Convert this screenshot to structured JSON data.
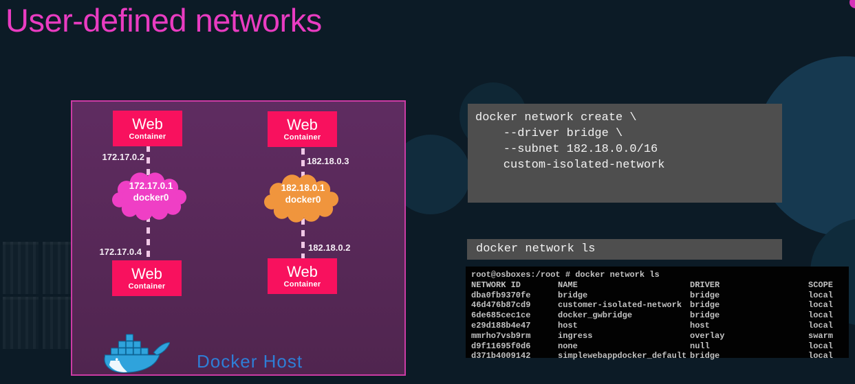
{
  "slide": {
    "title": "User-defined networks"
  },
  "colors": {
    "background": "#0c1b26",
    "title_magenta": "#e93cc1",
    "panel_purple": "#5a2a5c",
    "panel_border": "#cc3ba4",
    "container_box_pink": "#f8115e",
    "cloud_pink": "#ef3fc5",
    "cloud_orange": "#f0953d",
    "docker_host_blue": "#2e7ed6",
    "code_block_gray": "#4e4e4e",
    "terminal_black": "#020202"
  },
  "diagram": {
    "container_title": "Web",
    "container_subtitle": "Container",
    "host_label": "Docker Host",
    "networks": [
      {
        "top_ip": "172.17.0.2",
        "cloud_ip": "172.17.0.1",
        "cloud_name": "docker0",
        "bottom_ip": "172.17.0.4",
        "cloud_color": "#ef3fc5"
      },
      {
        "top_ip": "182.18.0.3",
        "cloud_ip": "182.18.0.1",
        "cloud_name": "docker0",
        "bottom_ip": "182.18.0.2",
        "cloud_color": "#f0953d"
      }
    ]
  },
  "code_create": {
    "lines": [
      "docker network create \\",
      "    --driver bridge \\",
      "    --subnet 182.18.0.0/16",
      "    custom-isolated-network"
    ]
  },
  "code_ls": {
    "command": "docker network ls"
  },
  "terminal": {
    "prompt": "root@osboxes:/root # docker network ls",
    "headers": [
      "NETWORK ID",
      "NAME",
      "DRIVER",
      "SCOPE"
    ],
    "rows": [
      [
        "dba0fb9370fe",
        "bridge",
        "bridge",
        "local"
      ],
      [
        "46d476b87cd9",
        "customer-isolated-network",
        "bridge",
        "local"
      ],
      [
        "6de685cec1ce",
        "docker_gwbridge",
        "bridge",
        "local"
      ],
      [
        "e29d188b4e47",
        "host",
        "host",
        "local"
      ],
      [
        "mmrho7vsb9rm",
        "ingress",
        "overlay",
        "swarm"
      ],
      [
        "d9f11695f0d6",
        "none",
        "null",
        "local"
      ],
      [
        "d371b4009142",
        "simplewebappdocker_default",
        "bridge",
        "local"
      ]
    ]
  }
}
